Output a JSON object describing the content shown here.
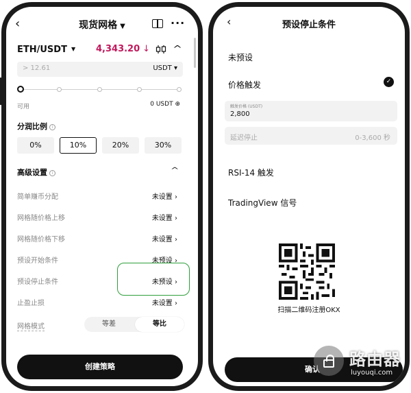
{
  "left": {
    "nav": {
      "title": "现货网格"
    },
    "pair": "ETH/USDT",
    "price": "4,343.20",
    "amount": {
      "placeholder": "> 12.61",
      "unit": "USDT"
    },
    "available": {
      "label": "可用",
      "value": "0 USDT"
    },
    "profit_ratio": {
      "title": "分润比例",
      "options": [
        "0%",
        "10%",
        "20%",
        "30%"
      ],
      "selected": "10%"
    },
    "advanced": {
      "title": "高级设置",
      "rows": [
        {
          "label": "简单赚币分配",
          "value": "未设置"
        },
        {
          "label": "网格随价格上移",
          "value": "未设置"
        },
        {
          "label": "网格随价格下移",
          "value": "未设置"
        },
        {
          "label": "预设开始条件",
          "value": "未预设"
        },
        {
          "label": "预设停止条件",
          "value": "未预设"
        },
        {
          "label": "止盈止损",
          "value": "未设置"
        }
      ]
    },
    "grid_mode": {
      "label": "网格模式",
      "options": [
        "等差",
        "等比"
      ],
      "selected": "等比"
    },
    "create_button": "创建策略"
  },
  "right": {
    "title": "预设停止条件",
    "options": [
      "未预设",
      "价格触发"
    ],
    "selected": "价格触发",
    "trigger_price": {
      "label": "触发价格 (USDT)",
      "value": "2,800"
    },
    "delay_stop": {
      "placeholder": "延迟停止",
      "range": "0-3,600 秒"
    },
    "other_options": [
      "RSI-14 触发",
      "TradingView 信号"
    ],
    "qr_caption": "扫描二维码注册OKX",
    "confirm_button": "确认"
  },
  "watermark": {
    "text": "路由器",
    "url": "luyouqi.com"
  },
  "colors": {
    "price_red": "#c2185b",
    "highlight_green": "#2e9e3a",
    "button_black": "#111111"
  }
}
